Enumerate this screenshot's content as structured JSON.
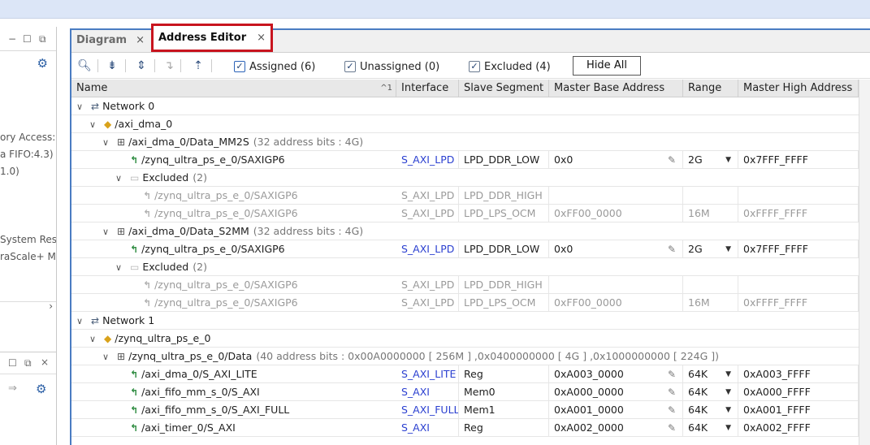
{
  "left_pane": {
    "text_lines": [
      "ory Access:",
      "a FIFO:4.3)",
      "1.0)",
      "System Res",
      "raScale+ M"
    ]
  },
  "tabs": [
    {
      "label": "Diagram",
      "close": "×"
    },
    {
      "label": "Address Editor",
      "close": "×"
    }
  ],
  "toolbar": {
    "assigned": "Assigned (6)",
    "unassigned": "Unassigned (0)",
    "excluded": "Excluded (4)",
    "hide_all": "Hide All",
    "check": "✓"
  },
  "columns": {
    "name": "Name",
    "sort": "^1",
    "interface": "Interface",
    "slave_segment": "Slave Segment",
    "master_base": "Master Base Address",
    "range": "Range",
    "master_high": "Master High Address"
  },
  "rows": [
    {
      "level": 0,
      "type": "network",
      "toggle": "∨",
      "name": "Network 0"
    },
    {
      "level": 1,
      "type": "ip",
      "toggle": "∨",
      "name": "/axi_dma_0"
    },
    {
      "level": 2,
      "type": "seg",
      "toggle": "∨",
      "name": "/axi_dma_0/Data_MM2S",
      "info": "(32 address bits : 4G)"
    },
    {
      "level": 3,
      "type": "slave",
      "name": "/zynq_ultra_ps_e_0/SAXIGP6",
      "interface": "S_AXI_LPD",
      "segment": "LPD_DDR_LOW",
      "base": "0x0",
      "range": "2G",
      "high": "0x7FFF_FFFF"
    },
    {
      "level": 3,
      "type": "folder",
      "toggle": "∨",
      "name": "Excluded",
      "info": "(2)"
    },
    {
      "level": 4,
      "type": "excluded",
      "name": "/zynq_ultra_ps_e_0/SAXIGP6",
      "interface": "S_AXI_LPD",
      "segment": "LPD_DDR_HIGH",
      "base": "",
      "range": "",
      "high": ""
    },
    {
      "level": 4,
      "type": "excluded",
      "name": "/zynq_ultra_ps_e_0/SAXIGP6",
      "interface": "S_AXI_LPD",
      "segment": "LPD_LPS_OCM",
      "base": "0xFF00_0000",
      "range": "16M",
      "high": "0xFFFF_FFFF"
    },
    {
      "level": 2,
      "type": "seg",
      "toggle": "∨",
      "name": "/axi_dma_0/Data_S2MM",
      "info": "(32 address bits : 4G)"
    },
    {
      "level": 3,
      "type": "slave",
      "name": "/zynq_ultra_ps_e_0/SAXIGP6",
      "interface": "S_AXI_LPD",
      "segment": "LPD_DDR_LOW",
      "base": "0x0",
      "range": "2G",
      "high": "0x7FFF_FFFF"
    },
    {
      "level": 3,
      "type": "folder",
      "toggle": "∨",
      "name": "Excluded",
      "info": "(2)"
    },
    {
      "level": 4,
      "type": "excluded",
      "name": "/zynq_ultra_ps_e_0/SAXIGP6",
      "interface": "S_AXI_LPD",
      "segment": "LPD_DDR_HIGH",
      "base": "",
      "range": "",
      "high": ""
    },
    {
      "level": 4,
      "type": "excluded",
      "name": "/zynq_ultra_ps_e_0/SAXIGP6",
      "interface": "S_AXI_LPD",
      "segment": "LPD_LPS_OCM",
      "base": "0xFF00_0000",
      "range": "16M",
      "high": "0xFFFF_FFFF"
    },
    {
      "level": 0,
      "type": "network",
      "toggle": "∨",
      "name": "Network 1"
    },
    {
      "level": 1,
      "type": "ip",
      "toggle": "∨",
      "name": "/zynq_ultra_ps_e_0"
    },
    {
      "level": 2,
      "type": "seg",
      "toggle": "∨",
      "name": "/zynq_ultra_ps_e_0/Data",
      "info": "(40 address bits : 0x00A0000000 [ 256M ] ,0x0400000000 [ 4G ] ,0x1000000000 [ 224G ])"
    },
    {
      "level": 3,
      "type": "slave",
      "name": "/axi_dma_0/S_AXI_LITE",
      "interface": "S_AXI_LITE",
      "segment": "Reg",
      "base": "0xA003_0000",
      "range": "64K",
      "high": "0xA003_FFFF"
    },
    {
      "level": 3,
      "type": "slave",
      "name": "/axi_fifo_mm_s_0/S_AXI",
      "interface": "S_AXI",
      "segment": "Mem0",
      "base": "0xA000_0000",
      "range": "64K",
      "high": "0xA000_FFFF"
    },
    {
      "level": 3,
      "type": "slave",
      "name": "/axi_fifo_mm_s_0/S_AXI_FULL",
      "interface": "S_AXI_FULL",
      "segment": "Mem1",
      "base": "0xA001_0000",
      "range": "64K",
      "high": "0xA001_FFFF"
    },
    {
      "level": 3,
      "type": "slave",
      "name": "/axi_timer_0/S_AXI",
      "interface": "S_AXI",
      "segment": "Reg",
      "base": "0xA002_0000",
      "range": "64K",
      "high": "0xA002_FFFF"
    }
  ],
  "icons": {
    "search": "search-icon",
    "collapse": "collapse-all-icon",
    "expand": "expand-all-icon",
    "gear": "gear-icon",
    "network": "network-icon",
    "ip": "ip-block-icon",
    "segment": "address-segment-icon",
    "slave": "slave-interface-icon",
    "folder": "folder-icon",
    "edit": "pencil-icon",
    "dropdown": "chevron-down-icon"
  },
  "colors": {
    "accent": "#4a7cc2",
    "highlight_box": "#c8141e",
    "link": "#2a3fd0"
  }
}
